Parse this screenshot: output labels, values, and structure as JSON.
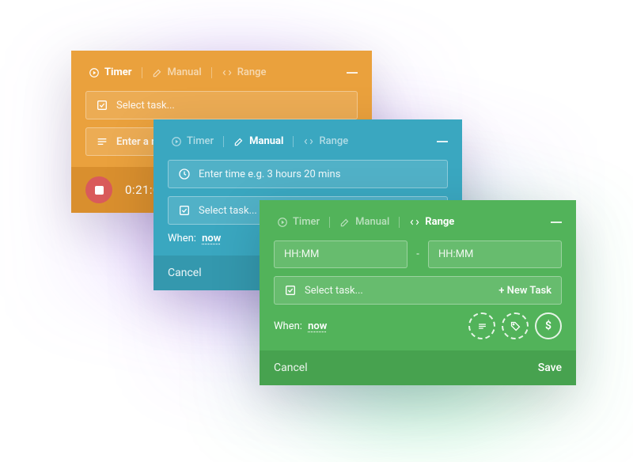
{
  "tabs": {
    "timer": "Timer",
    "manual": "Manual",
    "range": "Range"
  },
  "orange": {
    "task_placeholder": "Select task...",
    "note_placeholder": "Enter a note...",
    "timer_value": "0:21:00"
  },
  "blue": {
    "time_placeholder": "Enter time e.g. 3 hours 20 mins",
    "when_label": "When:",
    "when_value": "now",
    "cancel": "Cancel"
  },
  "green": {
    "hhmm": "HH:MM",
    "dash": "-",
    "task_placeholder": "Select task...",
    "new_task": "+ New Task",
    "when_label": "When:",
    "when_value": "now",
    "cancel": "Cancel",
    "save": "Save"
  },
  "icons": {
    "dollar": "$"
  }
}
